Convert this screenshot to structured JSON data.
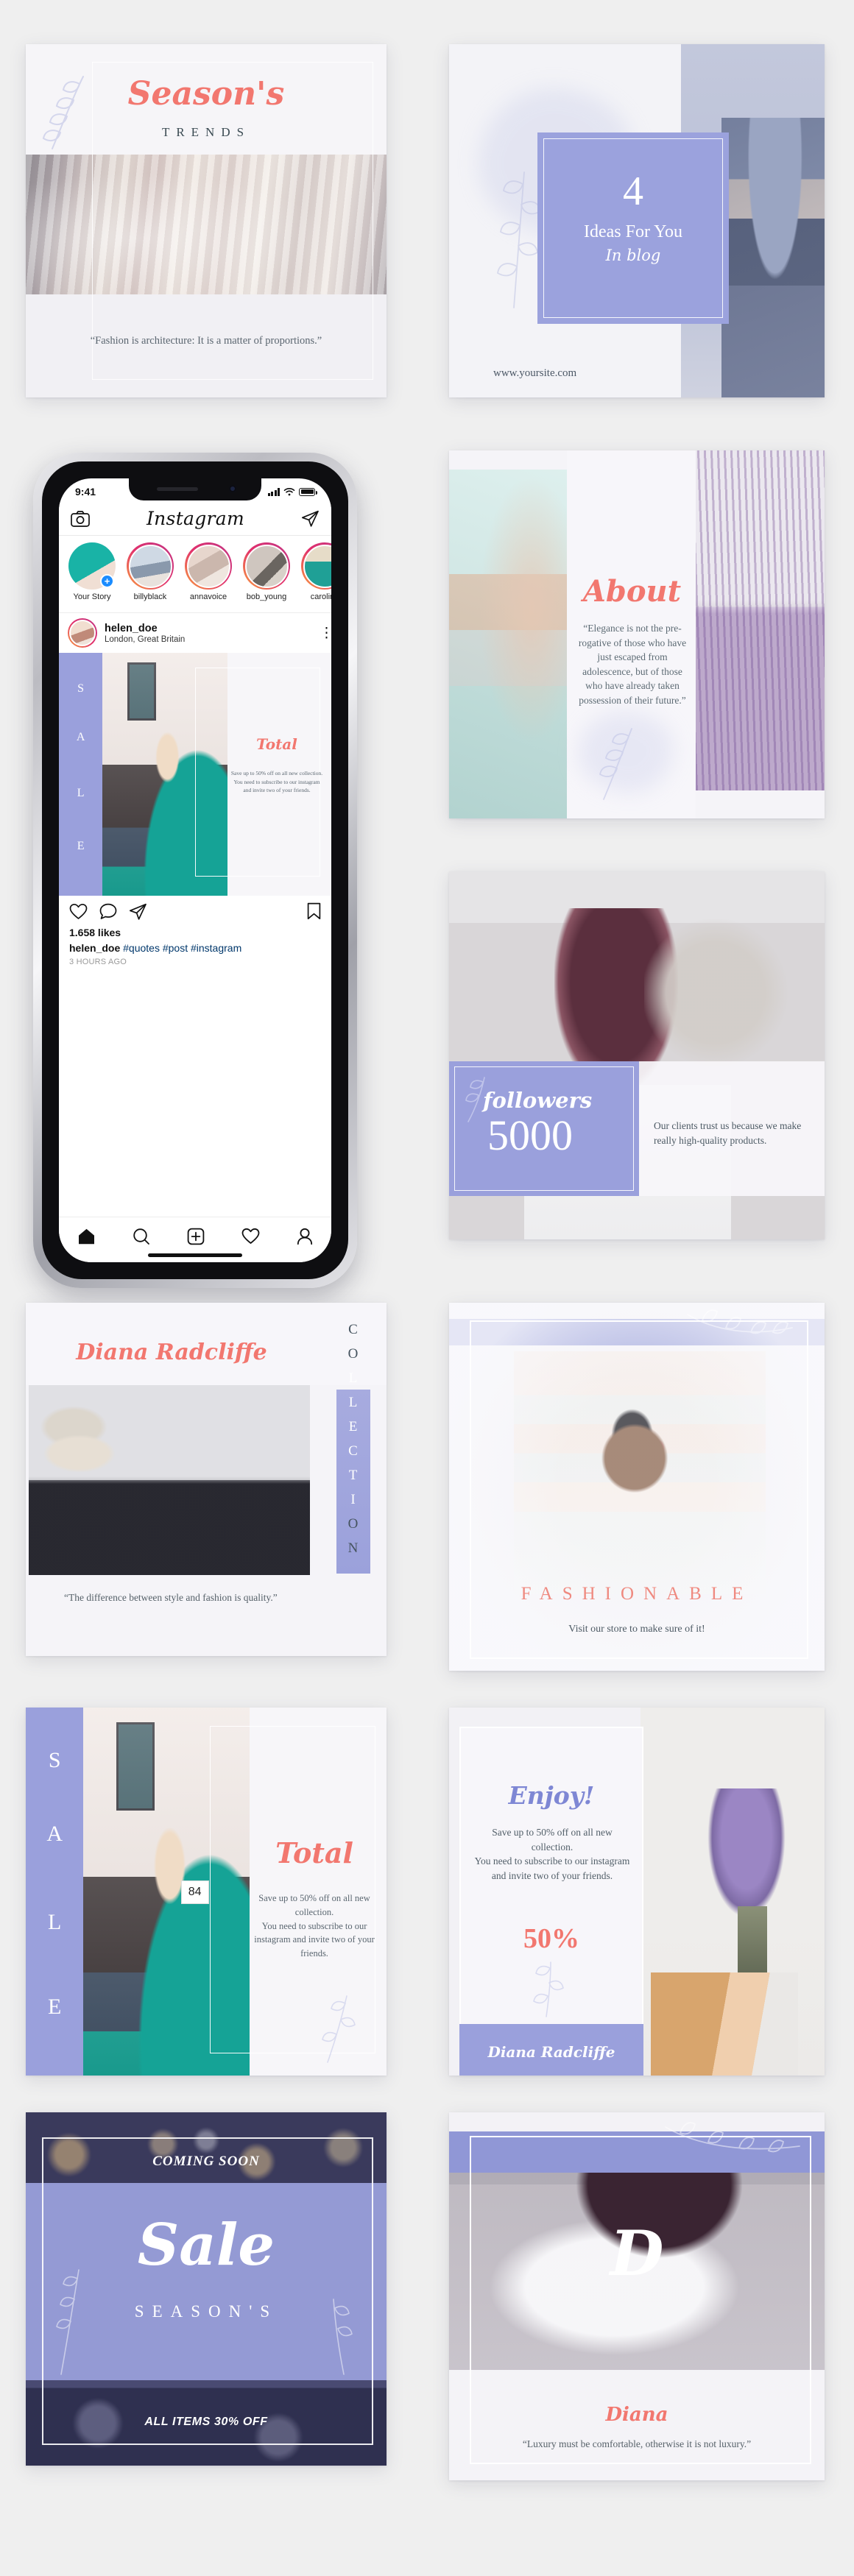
{
  "theme": {
    "accent_coral": "#f2776f",
    "accent_lavender": "#9aa0dc",
    "ink": "#3d4a55",
    "page_bg": "#efefef"
  },
  "cards": {
    "seasons_trends": {
      "title": "Season's",
      "subtitle": "TRENDS",
      "quote": "“Fashion is architecture: It is a matter of proportions.”"
    },
    "ideas": {
      "number": "4",
      "line1": "Ideas For You",
      "line2": "In blog",
      "url": "www.yoursite.com"
    },
    "about": {
      "title": "About",
      "quote": "“Elegance is not the pre-rogative of those who have just escaped from adolescence, but of those who have already taken possession of their future.”"
    },
    "followers": {
      "label": "followers",
      "count": "5000",
      "note": "Our clients trust us because we make really high-quality products."
    },
    "collection": {
      "name": "Diana Radcliffe",
      "vertical": "COLLECTION",
      "quote": "“The difference between style and fashion is quality.”"
    },
    "fashionable": {
      "title": "FASHIONABLE",
      "subtitle": "Visit our store to make sure of it!"
    },
    "sale_total": {
      "rail": "SALE",
      "title": "Total",
      "body": "Save up to 50% off on all new collection.\nYou need to subscribe to our instagram and invite two of your friends.",
      "sticker": "84"
    },
    "enjoy": {
      "title": "Enjoy!",
      "body": "Save up to 50% off on all new collection.\nYou need to subscribe to our instagram and invite two of your friends.",
      "percent": "50%",
      "footer_name": "Diana Radcliffe"
    },
    "coming_soon": {
      "kicker": "COMING SOON",
      "title": "Sale",
      "subtitle": "SEASON'S",
      "footer": "ALL ITEMS 30% OFF"
    },
    "diana": {
      "monogram": "D",
      "name": "Diana",
      "quote": "“Luxury must be comfortable, otherwise it is not luxury.”"
    }
  },
  "phone": {
    "status": {
      "time": "9:41",
      "signal_icon": "signal-bars-icon",
      "wifi_icon": "wifi-icon",
      "battery_icon": "battery-icon"
    },
    "app": {
      "logo": "Instagram",
      "camera_icon": "camera-icon",
      "direct_icon": "send-icon",
      "stories": [
        {
          "name": "Your Story",
          "own": true
        },
        {
          "name": "billyblack",
          "own": false
        },
        {
          "name": "annavoice",
          "own": false
        },
        {
          "name": "bob_young",
          "own": false
        },
        {
          "name": "caroline",
          "own": false
        }
      ],
      "post": {
        "username": "helen_doe",
        "location": "London, Great Britain",
        "menu_icon": "more-options-icon",
        "like_icon": "heart-icon",
        "comment_icon": "comment-icon",
        "share_icon": "send-icon",
        "save_icon": "bookmark-icon",
        "likes": "1.658 likes",
        "caption_user": "helen_doe",
        "caption_tags": "#quotes #post #instagram",
        "timestamp": "3 HOURS AGO",
        "art": {
          "rail": "SALE",
          "title": "Total",
          "body": "Save up to 50% off on all new collection.\nYou need to subscribe to our instagram and invite two of your friends."
        }
      },
      "tabbar": [
        {
          "icon": "home-icon",
          "active": true
        },
        {
          "icon": "search-icon",
          "active": false
        },
        {
          "icon": "add-post-icon",
          "active": false
        },
        {
          "icon": "activity-heart-icon",
          "active": false
        },
        {
          "icon": "profile-icon",
          "active": false
        }
      ]
    }
  }
}
